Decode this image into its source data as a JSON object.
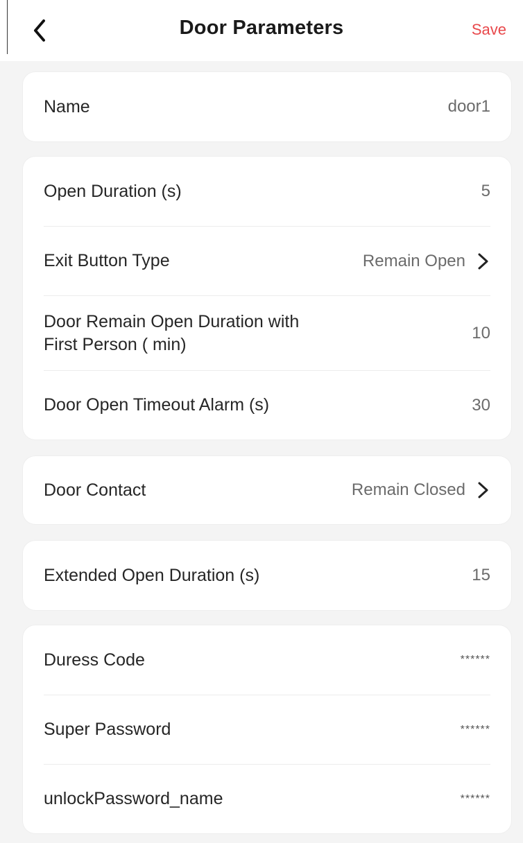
{
  "header": {
    "title": "Door Parameters",
    "save_label": "Save",
    "back_icon": "chevron-left-icon",
    "save_color": "#e8484b"
  },
  "rows": {
    "name": {
      "label": "Name",
      "value": "door1"
    },
    "open_duration": {
      "label": "Open Duration (s)",
      "value": "5"
    },
    "exit_button_type": {
      "label": "Exit Button Type",
      "value": "Remain Open",
      "icon": "chevron-right-icon"
    },
    "first_person_duration": {
      "label": "Door Remain Open Duration with First Person ( min)",
      "value": "10"
    },
    "open_timeout_alarm": {
      "label": "Door Open Timeout Alarm (s)",
      "value": "30"
    },
    "door_contact": {
      "label": "Door Contact",
      "value": "Remain Closed",
      "icon": "chevron-right-icon"
    },
    "extended_open_duration": {
      "label": "Extended Open Duration (s)",
      "value": "15"
    },
    "duress_code": {
      "label": "Duress Code",
      "value": "******"
    },
    "super_password": {
      "label": "Super Password",
      "value": "******"
    },
    "unlock_password": {
      "label": "unlockPassword_name",
      "value": "******"
    }
  }
}
